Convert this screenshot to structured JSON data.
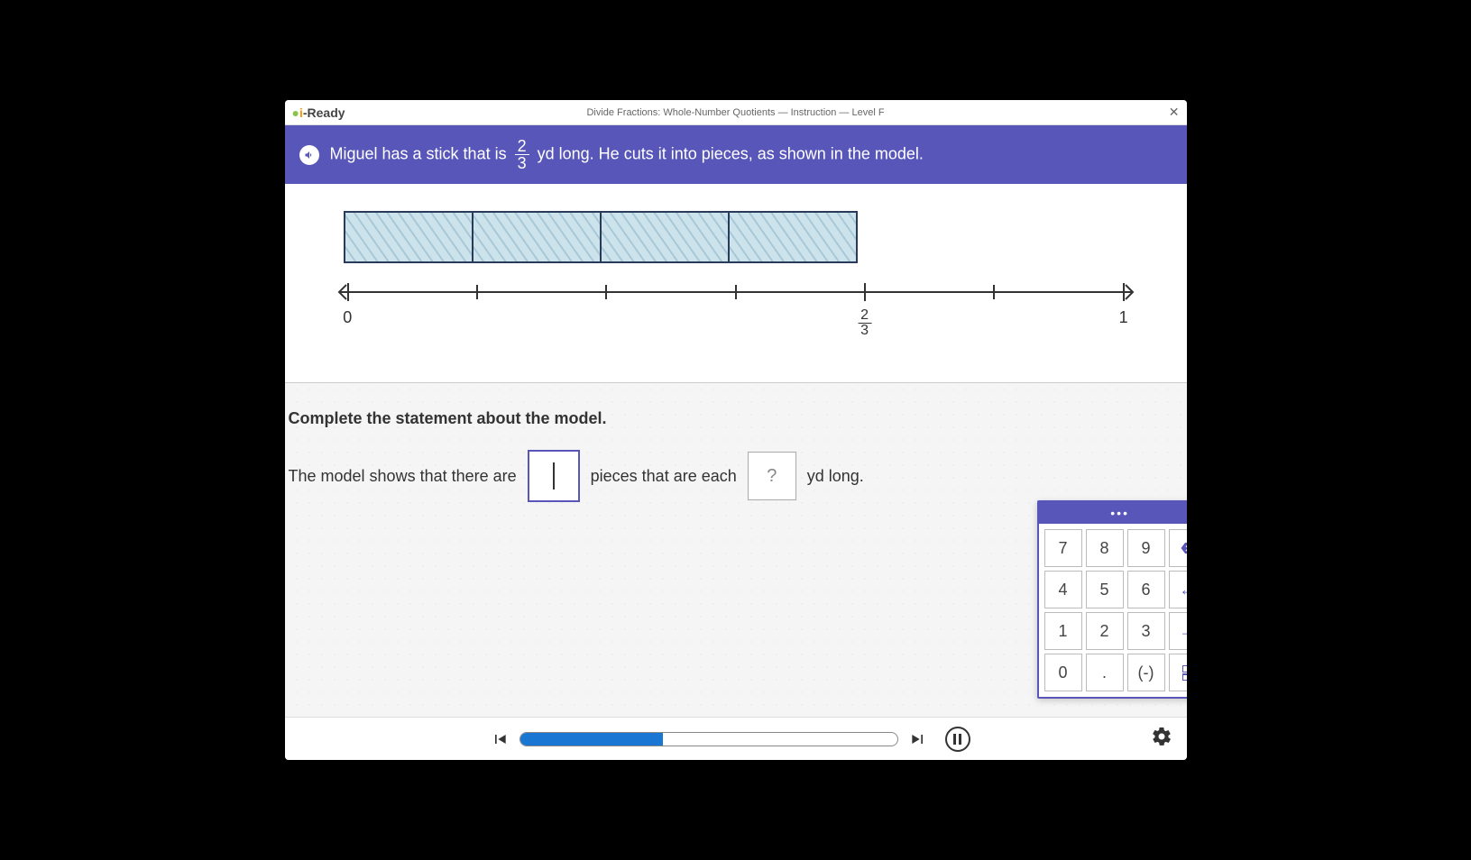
{
  "brand": "i-Ready",
  "lesson_title": "Divide Fractions: Whole-Number Quotients — Instruction — Level F",
  "prompt": {
    "pre": "Miguel has a stick that is",
    "frac_num": "2",
    "frac_den": "3",
    "post": "yd long. He cuts it into pieces, as shown in the model."
  },
  "numberline": {
    "labels": {
      "zero": "0",
      "two_thirds_num": "2",
      "two_thirds_den": "3",
      "one": "1"
    }
  },
  "question": {
    "instruction": "Complete the statement about the model.",
    "sentence_pre": "The model shows that there are",
    "sentence_mid": "pieces that are each",
    "sentence_post": "yd long.",
    "blank1_value": "",
    "blank2_placeholder": "?"
  },
  "keypad": {
    "keys": [
      "7",
      "8",
      "9",
      "⌫",
      "4",
      "5",
      "6",
      "←",
      "1",
      "2",
      "3",
      "→",
      "0",
      ".",
      "(-)",
      "frac"
    ]
  },
  "progress_percent": 38
}
